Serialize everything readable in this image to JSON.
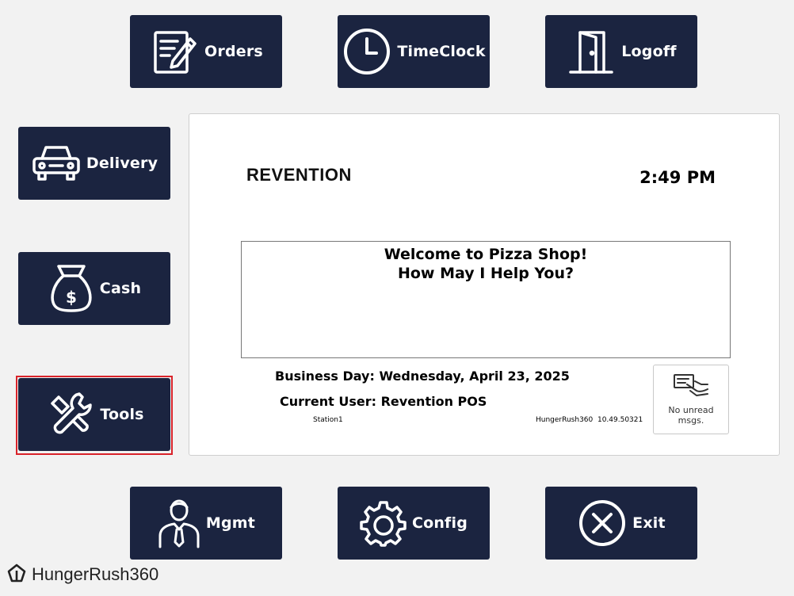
{
  "tiles": {
    "orders": {
      "label": "Orders",
      "icon": "order-pad-pencil-icon"
    },
    "timeclock": {
      "label": "TimeClock",
      "icon": "clock-icon"
    },
    "logoff": {
      "label": "Logoff",
      "icon": "door-icon"
    },
    "delivery": {
      "label": "Delivery",
      "icon": "car-icon"
    },
    "cash": {
      "label": "Cash",
      "icon": "money-bag-icon"
    },
    "tools": {
      "label": "Tools",
      "icon": "wrench-icon",
      "selected": true
    },
    "mgmt": {
      "label": "Mgmt",
      "icon": "manager-person-icon"
    },
    "config": {
      "label": "Config",
      "icon": "gear-icon"
    },
    "exit": {
      "label": "Exit",
      "icon": "close-circle-icon"
    }
  },
  "panel": {
    "brand": "REVENTION",
    "time": "2:49 PM",
    "welcome_line1": "Welcome to Pizza Shop!",
    "welcome_line2": "How May I Help You?",
    "business_day": "Business Day: Wednesday, April 23, 2025",
    "current_user": "Current User: Revention POS",
    "station": "Station1",
    "version": "HungerRush360  10.49.50321",
    "messages": "No unread msgs."
  },
  "footer": {
    "logo_text": "HungerRush360"
  },
  "colors": {
    "tile_bg": "#1b2440",
    "tile_fg": "#ffffff",
    "highlight": "#d9232a",
    "page_bg": "#f2f2f2"
  }
}
